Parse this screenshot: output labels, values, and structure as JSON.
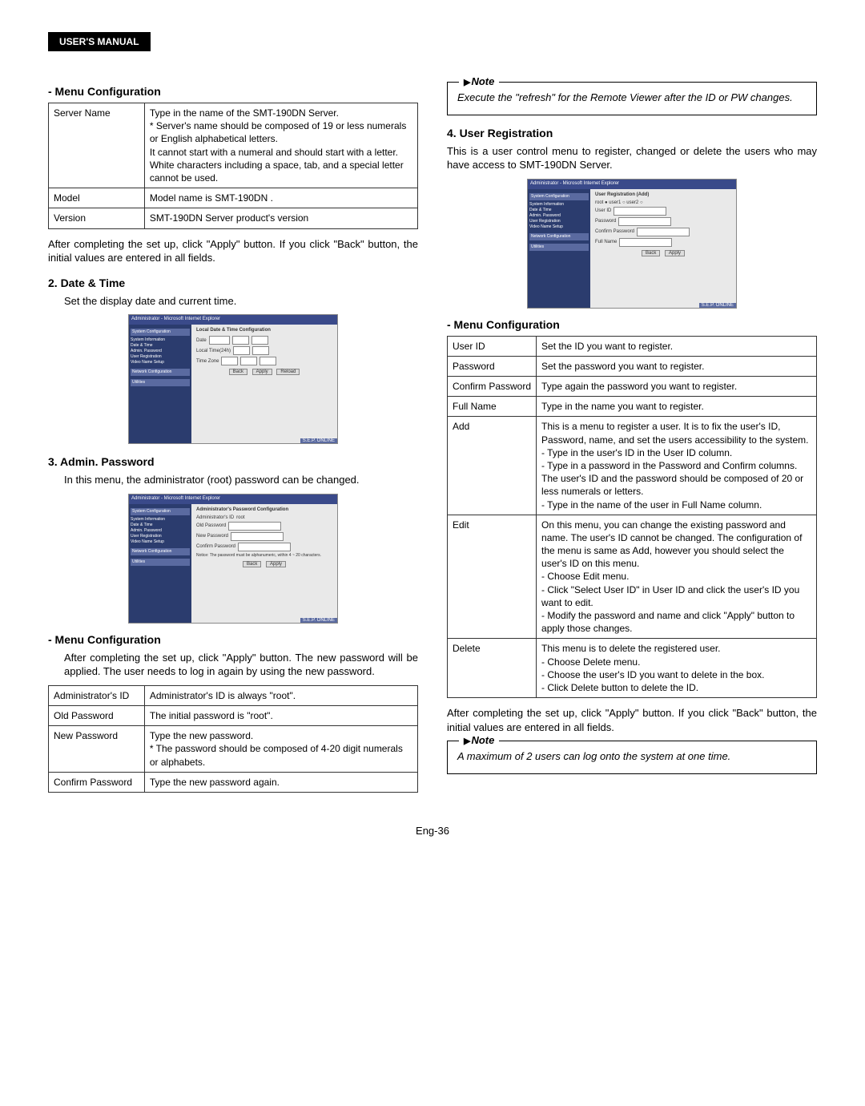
{
  "header": {
    "title": "USER'S MANUAL"
  },
  "left": {
    "menu_config_heading": "- Menu Configuration",
    "server_table": {
      "rows": [
        {
          "label": "Server Name",
          "desc": "Type in the name of the SMT-190DN Server.\n* Server's name should be composed of 19 or less numerals or English alphabetical letters.\nIt cannot start with a numeral and should start with a letter. White characters including a space, tab, and a special letter cannot be used."
        },
        {
          "label": "Model",
          "desc": "Model name is SMT-190DN ."
        },
        {
          "label": "Version",
          "desc": "SMT-190DN  Server product's version"
        }
      ]
    },
    "after_server_para": "After completing the set up, click \"Apply\" button. If you click \"Back\" button, the initial values are entered in all fields.",
    "date_time_heading": "2. Date & Time",
    "date_time_text": "Set the display date and current time.",
    "ss_datetime": {
      "titlebar": "Administrator - Microsoft Internet Explorer",
      "panel_title": "Local Date & Time Configuration",
      "sidebar_group1": "System Configuration",
      "sidebar_items1": [
        "System Information",
        "Date & Time",
        "Admin. Password",
        "User Registration",
        "Video Name Setup"
      ],
      "sidebar_group2": "Network Configuration",
      "sidebar_group3": "Utilities",
      "buttons": [
        "Back",
        "Apply",
        "Reload"
      ],
      "status": "S.E.P. ONLINE"
    },
    "admin_pw_heading": "3. Admin. Password",
    "admin_pw_text": "In this menu, the administrator (root) password can be changed.",
    "ss_adminpw": {
      "panel_title": "Administrator's Password Configuration",
      "fields": [
        "Administrator's ID",
        "Old Password",
        "New Password",
        "Confirm Password"
      ],
      "notice": "Notice: The password must be alphanumeric, within 4 ~ 20 characters.",
      "buttons": [
        "Back",
        "Apply"
      ]
    },
    "menu_config_heading2": "- Menu Configuration",
    "admin_after_para": "After completing the set up, click \"Apply\" button. The new password will be applied. The user needs to log in again by using the new password.",
    "admin_table": {
      "rows": [
        {
          "label": "Administrator's ID",
          "desc": "Administrator's ID is always \"root\"."
        },
        {
          "label": "Old Password",
          "desc": "The initial password is \"root\"."
        },
        {
          "label": "New Password",
          "desc": "Type the new password.\n* The password should be composed of 4-20 digit numerals or alphabets."
        },
        {
          "label": "Confirm Password",
          "desc": "Type the new password again."
        }
      ]
    }
  },
  "right": {
    "note1_label": "Note",
    "note1_text": "Execute the \"refresh\" for the Remote Viewer after the ID or PW changes.",
    "user_reg_heading": "4. User Registration",
    "user_reg_text": "This is a user control menu to register, changed or delete the users who may have access to SMT-190DN Server.",
    "ss_userreg": {
      "panel_title": "User Registration (Add)",
      "radios": "root ●   user1 ○   user2 ○",
      "fields": [
        "User ID",
        "Password",
        "Confirm Password",
        "Full Name"
      ],
      "buttons": [
        "Back",
        "Apply"
      ]
    },
    "menu_config_heading": "- Menu Configuration",
    "user_table": {
      "rows": [
        {
          "label": "User ID",
          "desc": "Set the ID you want to register."
        },
        {
          "label": "Password",
          "desc": "Set the password you want to register."
        },
        {
          "label": "Confirm Password",
          "desc": "Type again the password you want to register."
        },
        {
          "label": "Full Name",
          "desc": "Type in the name you want to register."
        },
        {
          "label": "Add",
          "desc": "This is a menu to register a user. It is to fix the user's ID, Password, name, and set the users accessibility to the system.\n- Type in the user's ID in the User ID column.\n- Type in a password in the Password and Confirm columns. The user's ID and the password should be composed of 20 or less numerals or letters.\n- Type in the name of the user in Full Name column."
        },
        {
          "label": "Edit",
          "desc": "On this menu, you can change the existing password and name. The user's ID cannot be changed. The configuration of the menu is same as Add, however you should select the user's ID on this menu.\n- Choose Edit menu.\n- Click \"Select User ID\" in User ID and click the user's ID you want to edit.\n- Modify the password and name and click \"Apply\" button to apply those changes."
        },
        {
          "label": "Delete",
          "desc": "This menu is to delete the registered user.\n- Choose Delete menu.\n- Choose the user's ID you want to delete in the box.\n- Click Delete button to delete the ID."
        }
      ]
    },
    "after_user_para": "After completing the set up, click \"Apply\" button. If you click \"Back\" button, the initial values are entered in all fields.",
    "note2_label": "Note",
    "note2_text": "A maximum of 2 users can log onto the system at one time."
  },
  "page_number": "Eng-36"
}
